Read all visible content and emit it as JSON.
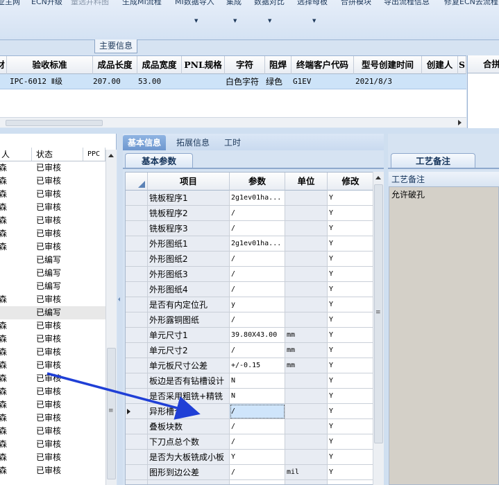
{
  "ribbon": {
    "items": [
      "业主网",
      "ECN升级",
      "量选并料图",
      "生成MI流程",
      "MI数据导入",
      "集成",
      "数据对比",
      "选择母板",
      "合拼模块",
      "导出流程信息",
      "修复ECN去流程"
    ],
    "section_label": "主要信息"
  },
  "top_grid": {
    "columns": [
      "材",
      "验收标准",
      "成品长度",
      "成品宽度",
      "PNL规格",
      "字符",
      "阻焊",
      "终端客户代码",
      "型号创建时间",
      "创建人",
      "S",
      "合拼"
    ],
    "row": [
      "",
      "IPC-6012 Ⅱ级",
      "207.00",
      "53.00",
      "",
      "白色字符",
      "绿色",
      "G1EV",
      "2021/8/3",
      ""
    ]
  },
  "left_panel": {
    "columns": [
      "人",
      "状态",
      "PPC"
    ],
    "rows": [
      {
        "a": "森",
        "status": "已审核"
      },
      {
        "a": "森",
        "status": "已审核"
      },
      {
        "a": "森",
        "status": "已审核"
      },
      {
        "a": "森",
        "status": "已审核"
      },
      {
        "a": "森",
        "status": "已审核"
      },
      {
        "a": "森",
        "status": "已审核"
      },
      {
        "a": "森",
        "status": "已审核"
      },
      {
        "a": "",
        "status": "已编写"
      },
      {
        "a": "",
        "status": "已编写"
      },
      {
        "a": "",
        "status": "已编写"
      },
      {
        "a": "森",
        "status": "已审核"
      },
      {
        "a": "",
        "status": "已编写"
      },
      {
        "a": "森",
        "status": "已审核"
      },
      {
        "a": "森",
        "status": "已审核"
      },
      {
        "a": "森",
        "status": "已审核"
      },
      {
        "a": "森",
        "status": "已审核"
      },
      {
        "a": "森",
        "status": "已审核"
      },
      {
        "a": "森",
        "status": "已审核"
      },
      {
        "a": "森",
        "status": "已审核"
      },
      {
        "a": "森",
        "status": "已审核"
      },
      {
        "a": "森",
        "status": "已审核"
      },
      {
        "a": "森",
        "status": "已审核"
      },
      {
        "a": "森",
        "status": "已审核"
      },
      {
        "a": "森",
        "status": "已审核"
      }
    ]
  },
  "tabs": [
    "基本信息",
    "拓展信息",
    "工时"
  ],
  "basic_params": {
    "subtab": "基本参数",
    "columns": [
      "项目",
      "参数",
      "单位",
      "修改"
    ],
    "rows": [
      {
        "item": "铣板程序1",
        "param": "2g1ev01ha...",
        "unit": "",
        "mod": "Y"
      },
      {
        "item": "铣板程序2",
        "param": "/",
        "unit": "",
        "mod": "Y"
      },
      {
        "item": "铣板程序3",
        "param": "/",
        "unit": "",
        "mod": "Y"
      },
      {
        "item": "外形图纸1",
        "param": "2g1ev01ha...",
        "unit": "",
        "mod": "Y"
      },
      {
        "item": "外形图纸2",
        "param": "/",
        "unit": "",
        "mod": "Y"
      },
      {
        "item": "外形图纸3",
        "param": "/",
        "unit": "",
        "mod": "Y"
      },
      {
        "item": "外形图纸4",
        "param": "/",
        "unit": "",
        "mod": "Y"
      },
      {
        "item": "是否有内定位孔",
        "param": "y",
        "unit": "",
        "mod": "Y"
      },
      {
        "item": "外形露铜图纸",
        "param": "/",
        "unit": "",
        "mod": "Y"
      },
      {
        "item": "单元尺寸1",
        "param": "39.80X43.00",
        "unit": "mm",
        "mod": "Y"
      },
      {
        "item": "单元尺寸2",
        "param": "/",
        "unit": "mm",
        "mod": "Y"
      },
      {
        "item": "单元板尺寸公差",
        "param": "+/-0.15",
        "unit": "mm",
        "mod": "Y"
      },
      {
        "item": "板边是否有钻槽设计",
        "param": "N",
        "unit": "",
        "mod": "Y"
      },
      {
        "item": "是否采用粗铣+精铣",
        "param": "N",
        "unit": "",
        "mod": "Y"
      },
      {
        "item": "异形槽个",
        "param": "/",
        "unit": "",
        "mod": "Y"
      },
      {
        "item": "叠板块数",
        "param": "/",
        "unit": "",
        "mod": "Y"
      },
      {
        "item": "下刀点总个数",
        "param": "/",
        "unit": "",
        "mod": "Y"
      },
      {
        "item": "是否为大板铣成小板",
        "param": "Y",
        "unit": "",
        "mod": "Y"
      },
      {
        "item": "图形到边公差",
        "param": "/",
        "unit": "mil",
        "mod": "Y"
      },
      {
        "item": "",
        "param": "",
        "unit": "",
        "mod": ""
      }
    ],
    "selected_row": 14
  },
  "process_notes": {
    "tab": "工艺备注",
    "header": "工艺备注",
    "text": "允许破孔"
  },
  "colors": {
    "accent": "#7aa2d8",
    "selection": "#cde3f8",
    "arrow": "#1f3fd6"
  }
}
